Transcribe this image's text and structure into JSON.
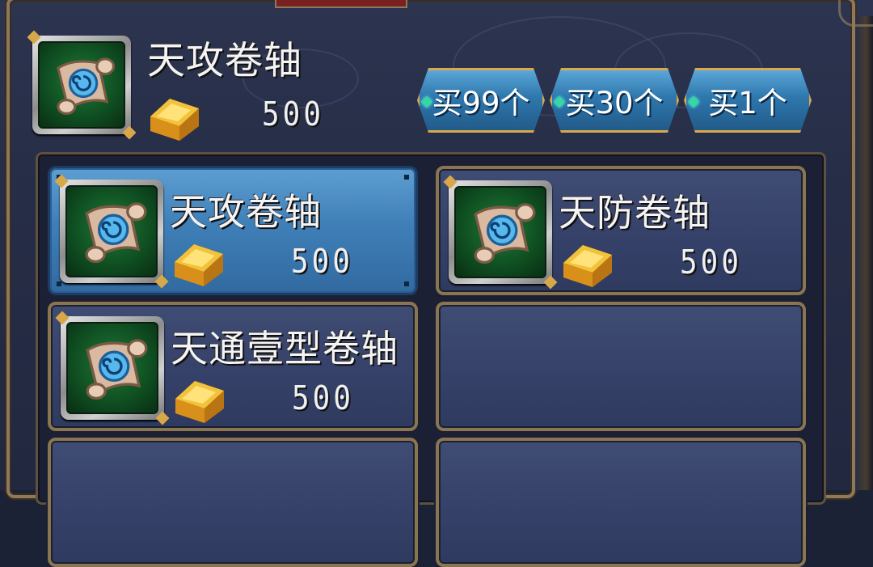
{
  "selected_item": {
    "name": "天攻卷轴",
    "price": "500",
    "icon": "scroll-icon",
    "currency_icon": "gold-ingot-icon"
  },
  "buy_buttons": [
    {
      "label": "买99个"
    },
    {
      "label": "买30个"
    },
    {
      "label": "买1个"
    }
  ],
  "items": [
    {
      "name": "天攻卷轴",
      "price": "500",
      "icon": "scroll-icon",
      "selected": true
    },
    {
      "name": "天防卷轴",
      "price": "500",
      "icon": "scroll-icon",
      "selected": false
    },
    {
      "name": "天通壹型卷轴",
      "price": "500",
      "icon": "scroll-icon",
      "selected": false
    },
    {
      "name": "",
      "price": "",
      "icon": "",
      "selected": false
    },
    {
      "name": "",
      "price": "",
      "icon": "",
      "selected": false
    },
    {
      "name": "",
      "price": "",
      "icon": "",
      "selected": false
    }
  ],
  "colors": {
    "panel_bg": "#262d46",
    "frame_gold": "#8d7a5c",
    "selected_cell": "#3f7fb7",
    "button_blue": "#2e77ad",
    "button_border": "#d8a84e"
  }
}
